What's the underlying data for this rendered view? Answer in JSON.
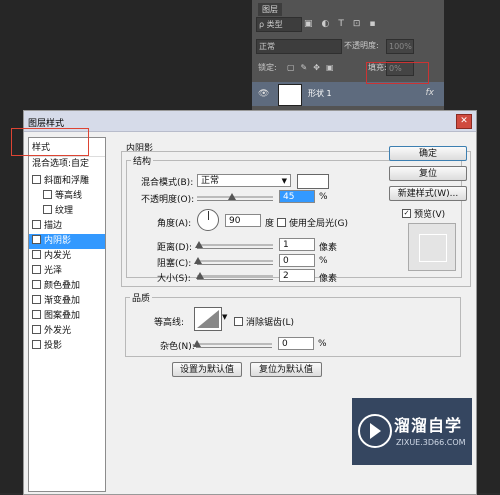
{
  "layers_panel": {
    "tab_label": "图层",
    "filter_label": "ρ 类型",
    "filter_icons": [
      "▣",
      "◐",
      "T",
      "⊡",
      "▪"
    ],
    "blend_mode": "正常",
    "opacity_label": "不透明度:",
    "opacity_value": "100%",
    "lock_label": "锁定:",
    "fill_label": "填充:",
    "fill_value": "0%",
    "layer_name": "形状 1",
    "fx_label": "fx"
  },
  "dialog": {
    "title": "图层样式",
    "close_label": "✕",
    "styles_header": "样式",
    "blend_options_label": "混合选项:自定",
    "style_items": [
      {
        "label": "斜面和浮雕",
        "checked": false,
        "indent": false
      },
      {
        "label": "等高线",
        "checked": false,
        "indent": true
      },
      {
        "label": "纹理",
        "checked": false,
        "indent": true
      },
      {
        "label": "描边",
        "checked": false,
        "indent": false
      },
      {
        "label": "内阴影",
        "checked": true,
        "indent": false,
        "selected": true
      },
      {
        "label": "内发光",
        "checked": false,
        "indent": false
      },
      {
        "label": "光泽",
        "checked": false,
        "indent": false
      },
      {
        "label": "颜色叠加",
        "checked": false,
        "indent": false
      },
      {
        "label": "渐变叠加",
        "checked": false,
        "indent": false
      },
      {
        "label": "图案叠加",
        "checked": false,
        "indent": false
      },
      {
        "label": "外发光",
        "checked": false,
        "indent": false
      },
      {
        "label": "投影",
        "checked": false,
        "indent": false
      }
    ],
    "inner_shadow": {
      "section_title": "内阴影",
      "structure_title": "结构",
      "blend_mode_label": "混合模式(B):",
      "blend_mode_value": "正常",
      "opacity_label": "不透明度(O):",
      "opacity_value": "45",
      "percent": "%",
      "angle_label": "角度(A):",
      "angle_value": "90",
      "degree_label": "度",
      "global_light_label": "使用全局光(G)",
      "distance_label": "距离(D):",
      "distance_value": "1",
      "choke_label": "阻塞(C):",
      "choke_value": "0",
      "size_label": "大小(S):",
      "size_value": "2",
      "pixel_label": "像素",
      "quality_title": "品质",
      "contour_label": "等高线:",
      "antialias_label": "消除锯齿(L)",
      "noise_label": "杂色(N):",
      "noise_value": "0",
      "set_default_label": "设置为默认值",
      "reset_default_label": "复位为默认值"
    },
    "buttons": {
      "ok": "确定",
      "reset": "复位",
      "new_style": "新建样式(W)...",
      "preview_label": "预览(V)"
    }
  },
  "watermark": {
    "title": "溜溜自学",
    "url": "ZIXUE.3D66.COM"
  }
}
